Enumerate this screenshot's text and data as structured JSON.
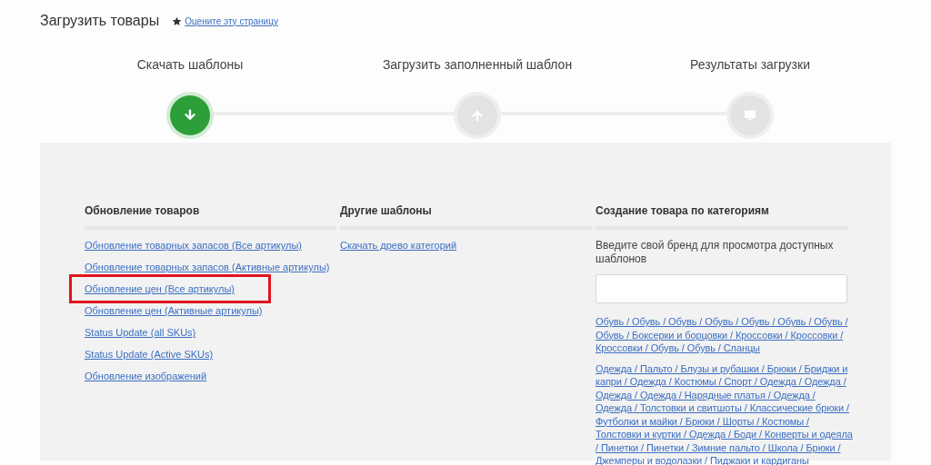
{
  "page": {
    "title": "Загрузить товары",
    "rate_link": "Оцените эту страницу"
  },
  "steps": [
    {
      "label": "Скачать шаблоны",
      "kind": "download",
      "selected": true
    },
    {
      "label": "Загрузить заполненный шаблон",
      "kind": "upload",
      "selected": false
    },
    {
      "label": "Результаты загрузки",
      "kind": "results",
      "selected": false
    }
  ],
  "columns": [
    {
      "heading": "Обновление товаров",
      "links": [
        {
          "text": "Обновление товарных запасов (Все артикулы)",
          "highlighted": false
        },
        {
          "text": "Обновление товарных запасов (Активные артикулы)",
          "highlighted": false
        },
        {
          "text": "Обновление цен (Все артикулы)",
          "highlighted": true
        },
        {
          "text": "Обновление цен (Активные артикулы)",
          "highlighted": false
        },
        {
          "text": "Status Update (all SKUs)",
          "highlighted": false
        },
        {
          "text": "Status Update (Active SKUs)",
          "highlighted": false
        },
        {
          "text": "Обновление изображений",
          "highlighted": false
        }
      ]
    },
    {
      "heading": "Другие шаблоны",
      "links": [
        {
          "text": "Скачать древо категорий",
          "highlighted": false
        }
      ]
    }
  ],
  "category_panel": {
    "heading": "Создание товара по категориям",
    "prompt": "Введите свой бренд для просмотра доступных шаблонов",
    "category_links": [
      "Обувь / Обувь / Обувь / Обувь / Обувь / Обувь / Обувь / Обувь / Боксерки и борцовки / Кроссовки / Кроссовки / Кроссовки / Обувь / Обувь / Сланцы",
      "Одежда / Пальто / Блузы и рубашки / Брюки / Бриджи и капри / Одежда / Костюмы / Спорт / Одежда / Одежда / Одежда / Одежда / Нарядные платья / Одежда / Одежда / Толстовки и свитшоты / Классические брюки / Футболки и майки / Брюки / Шорты / Костюмы / Толстовки и куртки / Одежда / Боди / Конверты и одеяла / Пинетки / Пинетки / Зимние пальто / Школа / Брюки / Джемперы и водолазки / Пиджаки и кардиганы"
    ]
  }
}
